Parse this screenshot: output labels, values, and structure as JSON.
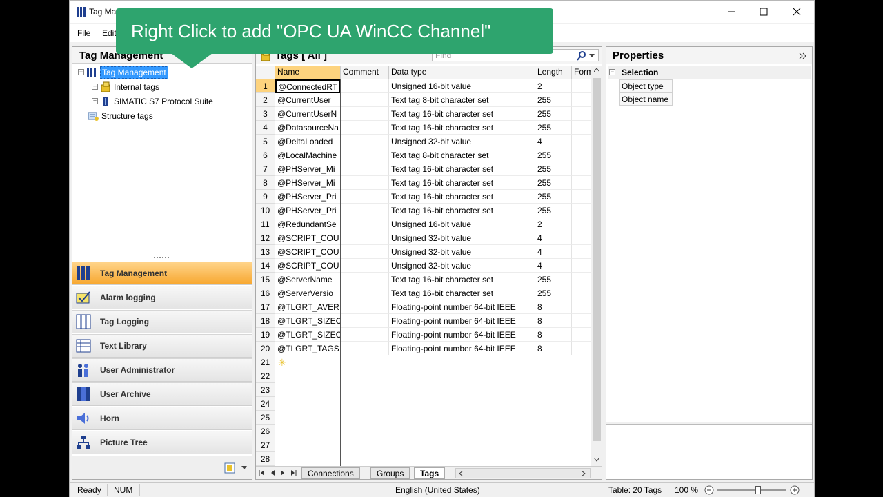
{
  "window": {
    "title": "Tag Ma"
  },
  "menu": {
    "file": "File",
    "edit": "Edit"
  },
  "callout": {
    "text": "Right Click to add \"OPC UA WinCC Channel\""
  },
  "left_panel": {
    "title": "Tag Management",
    "tree": [
      {
        "label": "Tag Management",
        "icon": "tag-management-icon",
        "level": 0,
        "selected": true
      },
      {
        "label": "Internal tags",
        "icon": "internal-tags-icon",
        "level": 1
      },
      {
        "label": "SIMATIC S7 Protocol Suite",
        "icon": "channel-icon",
        "level": 1
      },
      {
        "label": "Structure tags",
        "icon": "structure-tags-icon",
        "level": 0
      }
    ],
    "nav": [
      {
        "label": "Tag Management",
        "icon": "tag-management-icon",
        "active": true
      },
      {
        "label": "Alarm logging",
        "icon": "alarm-logging-icon"
      },
      {
        "label": "Tag Logging",
        "icon": "tag-logging-icon"
      },
      {
        "label": "Text Library",
        "icon": "text-library-icon"
      },
      {
        "label": "User Administrator",
        "icon": "user-administrator-icon"
      },
      {
        "label": "User Archive",
        "icon": "user-archive-icon"
      },
      {
        "label": "Horn",
        "icon": "horn-icon"
      },
      {
        "label": "Picture Tree",
        "icon": "picture-tree-icon"
      }
    ]
  },
  "center": {
    "title": "Tags [ All ]",
    "find_placeholder": "Find",
    "columns": [
      "Name",
      "Comment",
      "Data type",
      "Length",
      "Form"
    ],
    "rows": [
      {
        "num": "1",
        "name": "@ConnectedRT",
        "comment": "",
        "type": "Unsigned 16-bit value",
        "length": "2"
      },
      {
        "num": "2",
        "name": "@CurrentUser",
        "comment": "",
        "type": "Text tag 8-bit character set",
        "length": "255"
      },
      {
        "num": "3",
        "name": "@CurrentUserN",
        "comment": "",
        "type": "Text tag 16-bit character set",
        "length": "255"
      },
      {
        "num": "4",
        "name": "@DatasourceNa",
        "comment": "",
        "type": "Text tag 16-bit character set",
        "length": "255"
      },
      {
        "num": "5",
        "name": "@DeltaLoaded",
        "comment": "",
        "type": "Unsigned 32-bit value",
        "length": "4"
      },
      {
        "num": "6",
        "name": "@LocalMachine",
        "comment": "",
        "type": "Text tag 8-bit character set",
        "length": "255"
      },
      {
        "num": "7",
        "name": "@PHServer_Mi",
        "comment": "",
        "type": "Text tag 16-bit character set",
        "length": "255"
      },
      {
        "num": "8",
        "name": "@PHServer_Mi",
        "comment": "",
        "type": "Text tag 16-bit character set",
        "length": "255"
      },
      {
        "num": "9",
        "name": "@PHServer_Pri",
        "comment": "",
        "type": "Text tag 16-bit character set",
        "length": "255"
      },
      {
        "num": "10",
        "name": "@PHServer_Pri",
        "comment": "",
        "type": "Text tag 16-bit character set",
        "length": "255"
      },
      {
        "num": "11",
        "name": "@RedundantSe",
        "comment": "",
        "type": "Unsigned 16-bit value",
        "length": "2"
      },
      {
        "num": "12",
        "name": "@SCRIPT_COU",
        "comment": "",
        "type": "Unsigned 32-bit value",
        "length": "4"
      },
      {
        "num": "13",
        "name": "@SCRIPT_COU",
        "comment": "",
        "type": "Unsigned 32-bit value",
        "length": "4"
      },
      {
        "num": "14",
        "name": "@SCRIPT_COU",
        "comment": "",
        "type": "Unsigned 32-bit value",
        "length": "4"
      },
      {
        "num": "15",
        "name": "@ServerName",
        "comment": "",
        "type": "Text tag 16-bit character set",
        "length": "255"
      },
      {
        "num": "16",
        "name": "@ServerVersio",
        "comment": "",
        "type": "Text tag 16-bit character set",
        "length": "255"
      },
      {
        "num": "17",
        "name": "@TLGRT_AVER",
        "comment": "",
        "type": "Floating-point number 64-bit IEEE",
        "length": "8"
      },
      {
        "num": "18",
        "name": "@TLGRT_SIZEC",
        "comment": "",
        "type": "Floating-point number 64-bit IEEE",
        "length": "8"
      },
      {
        "num": "19",
        "name": "@TLGRT_SIZEC",
        "comment": "",
        "type": "Floating-point number 64-bit IEEE",
        "length": "8"
      },
      {
        "num": "20",
        "name": "@TLGRT_TAGS",
        "comment": "",
        "type": "Floating-point number 64-bit IEEE",
        "length": "8"
      }
    ],
    "empty_rows": [
      "21",
      "22",
      "23",
      "24",
      "25",
      "26",
      "27",
      "28"
    ],
    "tabs": [
      "Connections",
      "Groups",
      "Tags"
    ],
    "active_tab": "Tags"
  },
  "properties": {
    "title": "Properties",
    "section": "Selection",
    "rows": [
      "Object type",
      "Object name"
    ]
  },
  "status": {
    "ready": "Ready",
    "num": "NUM",
    "language": "English (United States)",
    "table_count": "Table: 20 Tags",
    "zoom": "100 %",
    "zoom_level": 0.6
  },
  "colors": {
    "accent_orange": "#f7a72f",
    "selected_blue": "#3399ff",
    "callout_green": "#2ea46e",
    "header_orange": "#fdd37e"
  }
}
